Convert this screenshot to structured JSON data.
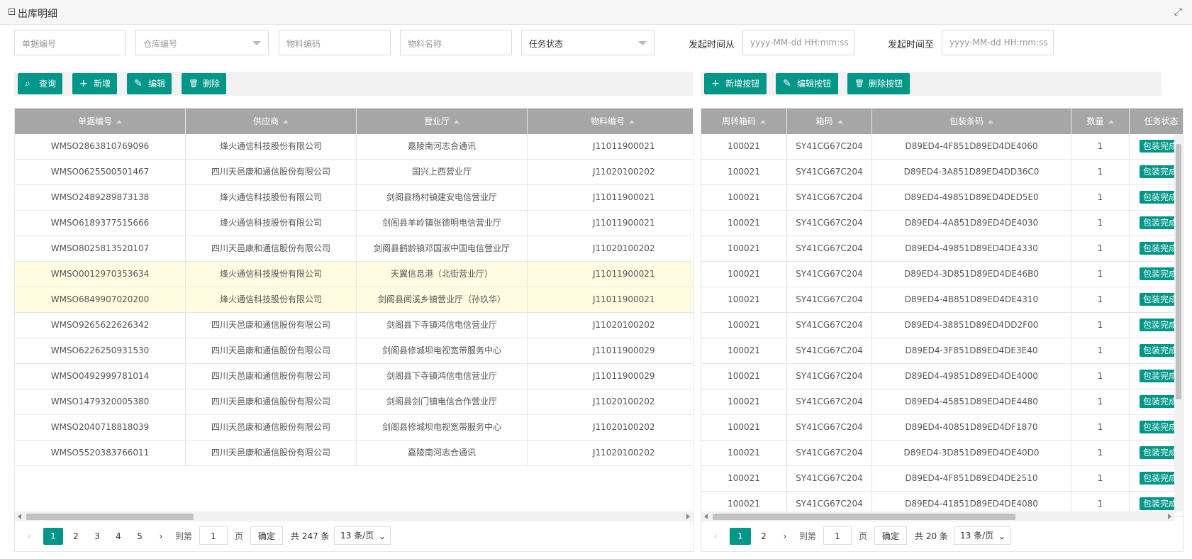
{
  "page": {
    "title": "出库明细"
  },
  "filters": {
    "doc_no": "单据编号",
    "warehouse_no": "仓库编号",
    "material_code": "物料编码",
    "material_name": "物料名称",
    "task_status": "任务状态",
    "start_from_label": "发起时间从",
    "start_from_placeholder": "yyyy-MM-dd HH:mm:ss",
    "start_to_label": "发起时间至",
    "start_to_placeholder": "yyyy-MM-dd HH:mm:ss"
  },
  "toolbar_left": [
    {
      "icon": "search-icon",
      "glyph": "⌕",
      "label": "查询"
    },
    {
      "icon": "plus-icon",
      "glyph": "+",
      "label": "新增"
    },
    {
      "icon": "edit-icon",
      "glyph": "✎",
      "label": "编辑"
    },
    {
      "icon": "trash-icon",
      "glyph": "🗑",
      "label": "删除"
    }
  ],
  "toolbar_right": [
    {
      "icon": "plus-icon",
      "glyph": "+",
      "label": "新增按钮"
    },
    {
      "icon": "edit-icon",
      "glyph": "✎",
      "label": "编辑按钮"
    },
    {
      "icon": "trash-icon",
      "glyph": "🗑",
      "label": "删除按钮"
    }
  ],
  "left_table": {
    "columns": [
      "单据编号",
      "供应商",
      "营业厅",
      "物料编号"
    ],
    "rows": [
      [
        "WMSO2863810769096",
        "烽火通信科技股份有限公司",
        "嘉陵南河志合通讯",
        "J11011900021"
      ],
      [
        "WMSO0625500501467",
        "四川天邑康和通信股份有限公司",
        "国兴上西营业厅",
        "J11020100202"
      ],
      [
        "WMSO2489289873138",
        "烽火通信科技股份有限公司",
        "剑阁县杨村镇建安电信营业厅",
        "J11011900021"
      ],
      [
        "WMSO6189377515666",
        "烽火通信科技股份有限公司",
        "剑阁县羊岭镇张德明电信营业厅",
        "J11011900021"
      ],
      [
        "WMSO8025813520107",
        "四川天邑康和通信股份有限公司",
        "剑阁县鹤龄镇邓国淑中国电信营业厅",
        "J11020100202"
      ],
      [
        "WMSO0012970353634",
        "烽火通信科技股份有限公司",
        "天翼信息港（北街营业厅）",
        "J11011900021"
      ],
      [
        "WMSO6849907020200",
        "烽火通信科技股份有限公司",
        "剑阁县闻溪乡镇营业厅（孙玖华）",
        "J11011900021"
      ],
      [
        "WMSO9265622626342",
        "四川天邑康和通信股份有限公司",
        "剑阁县下寺镇鸿信电信营业厅",
        "J11020100202"
      ],
      [
        "WMSO6226250931530",
        "四川天邑康和通信股份有限公司",
        "剑阁县修城坝电视宽带服务中心",
        "J11011900029"
      ],
      [
        "WMSO0492999781014",
        "四川天邑康和通信股份有限公司",
        "剑阁县下寺镇鸿信电信营业厅",
        "J11011900029"
      ],
      [
        "WMSO1479320005380",
        "四川天邑康和通信股份有限公司",
        "剑阁县剑门镇电信合作营业厅",
        "J11020100202"
      ],
      [
        "WMSO2040718818039",
        "四川天邑康和通信股份有限公司",
        "剑阁县修城坝电视宽带服务中心",
        "J11020100202"
      ],
      [
        "WMSO5520383766011",
        "四川天邑康和通信股份有限公司",
        "嘉陵南河志合通讯",
        "J11020100202"
      ]
    ],
    "highlighted_rows": [
      5,
      6
    ]
  },
  "right_table": {
    "columns": [
      "周转箱码",
      "箱码",
      "包装条码",
      "数量",
      "任务状态"
    ],
    "rows": [
      [
        "100021",
        "SY41CG67C204",
        "D89ED4-4F851D89ED4DE4060",
        "1",
        "包装完成"
      ],
      [
        "100021",
        "SY41CG67C204",
        "D89ED4-3A851D89ED4DD36C0",
        "1",
        "包装完成"
      ],
      [
        "100021",
        "SY41CG67C204",
        "D89ED4-49851D89ED4DED5E0",
        "1",
        "包装完成"
      ],
      [
        "100021",
        "SY41CG67C204",
        "D89ED4-4A851D89ED4DE4030",
        "1",
        "包装完成"
      ],
      [
        "100021",
        "SY41CG67C204",
        "D89ED4-49851D89ED4DE4330",
        "1",
        "包装完成"
      ],
      [
        "100021",
        "SY41CG67C204",
        "D89ED4-3D851D89ED4DE46B0",
        "1",
        "包装完成"
      ],
      [
        "100021",
        "SY41CG67C204",
        "D89ED4-4B851D89ED4DE4310",
        "1",
        "包装完成"
      ],
      [
        "100021",
        "SY41CG67C204",
        "D89ED4-38851D89ED4DD2F00",
        "1",
        "包装完成"
      ],
      [
        "100021",
        "SY41CG67C204",
        "D89ED4-3F851D89ED4DE3E40",
        "1",
        "包装完成"
      ],
      [
        "100021",
        "SY41CG67C204",
        "D89ED4-49851D89ED4DE4000",
        "1",
        "包装完成"
      ],
      [
        "100021",
        "SY41CG67C204",
        "D89ED4-45851D89ED4DE4480",
        "1",
        "包装完成"
      ],
      [
        "100021",
        "SY41CG67C204",
        "D89ED4-40851D89ED4DF1870",
        "1",
        "包装完成"
      ],
      [
        "100021",
        "SY41CG67C204",
        "D89ED4-3D851D89ED4DE40D0",
        "1",
        "包装完成"
      ],
      [
        "100021",
        "SY41CG67C204",
        "D89ED4-4F851D89ED4DE2510",
        "1",
        "包装完成"
      ],
      [
        "100021",
        "SY41CG67C204",
        "D89ED4-41851D89ED4DE4080",
        "1",
        "包装完成"
      ]
    ]
  },
  "left_pager": {
    "pages": [
      "1",
      "2",
      "3",
      "4",
      "5"
    ],
    "goto_label": "到第",
    "goto_value": "1",
    "page_unit": "页",
    "confirm": "确定",
    "total": "共 247 条",
    "page_size": "13 条/页"
  },
  "right_pager": {
    "pages": [
      "1",
      "2"
    ],
    "goto_label": "到第",
    "goto_value": "1",
    "page_unit": "页",
    "confirm": "确定",
    "total": "共 20 条",
    "page_size": "13 条/页"
  },
  "colors": {
    "accent": "#009688",
    "header": "#a6a6a6",
    "highlight": "#fffde1"
  }
}
